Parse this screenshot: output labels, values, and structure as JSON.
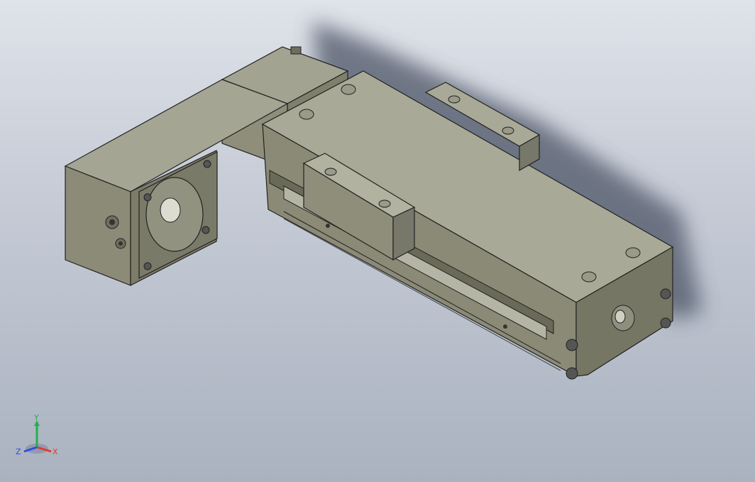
{
  "viewport": {
    "background_top": "#dfe3ea",
    "background_bottom": "#aab2c0",
    "model_color": "#8a8a78"
  },
  "triad": {
    "y_label": "Y",
    "x_label": "X",
    "z_label": "Z",
    "y_color": "#22b14c",
    "x_color": "#e23b2e",
    "z_color": "#2f4fd6"
  }
}
